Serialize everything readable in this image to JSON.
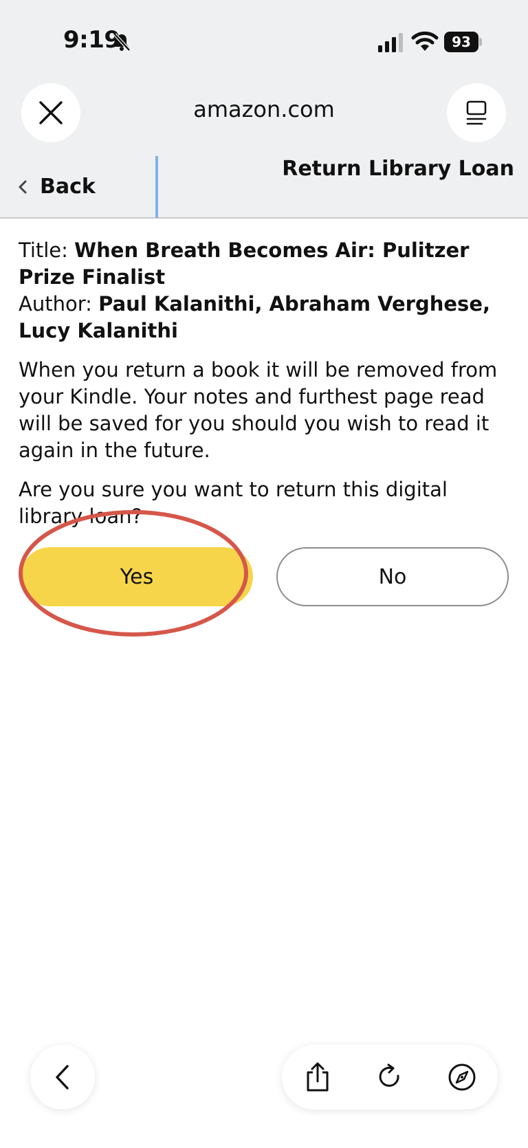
{
  "status_bar": {
    "time": "9:19",
    "battery": "93",
    "icons": [
      "bell-slash-icon",
      "signal-icon",
      "wifi-icon",
      "battery-icon"
    ]
  },
  "browser": {
    "domain": "amazon.com",
    "close_icon": "close-icon",
    "reader_icon": "reader-mode-icon"
  },
  "nav": {
    "back_label": "Back",
    "page_title": "Return Library Loan"
  },
  "book": {
    "title_label": "Title: ",
    "title_value": "When Breath Becomes Air: Pulitzer Prize Finalist",
    "author_label": "Author: ",
    "author_value": "Paul Kalanithi, Abraham Verghese, Lucy Kalanithi"
  },
  "message": {
    "info": "When you return a book it will be removed from your Kindle. Your notes and furthest page read will be saved for you should you wish to read it again in the future.",
    "question": "Are you sure you want to return this digital library loan?"
  },
  "actions": {
    "yes_label": "Yes",
    "no_label": "No"
  },
  "toolbar": {
    "icons": [
      "back-arrow-icon",
      "share-icon",
      "reload-icon",
      "compass-icon"
    ]
  },
  "colors": {
    "yes_button": "#f7d54a",
    "annotation_ring": "#d5574a",
    "divider": "#7fb1ea"
  }
}
